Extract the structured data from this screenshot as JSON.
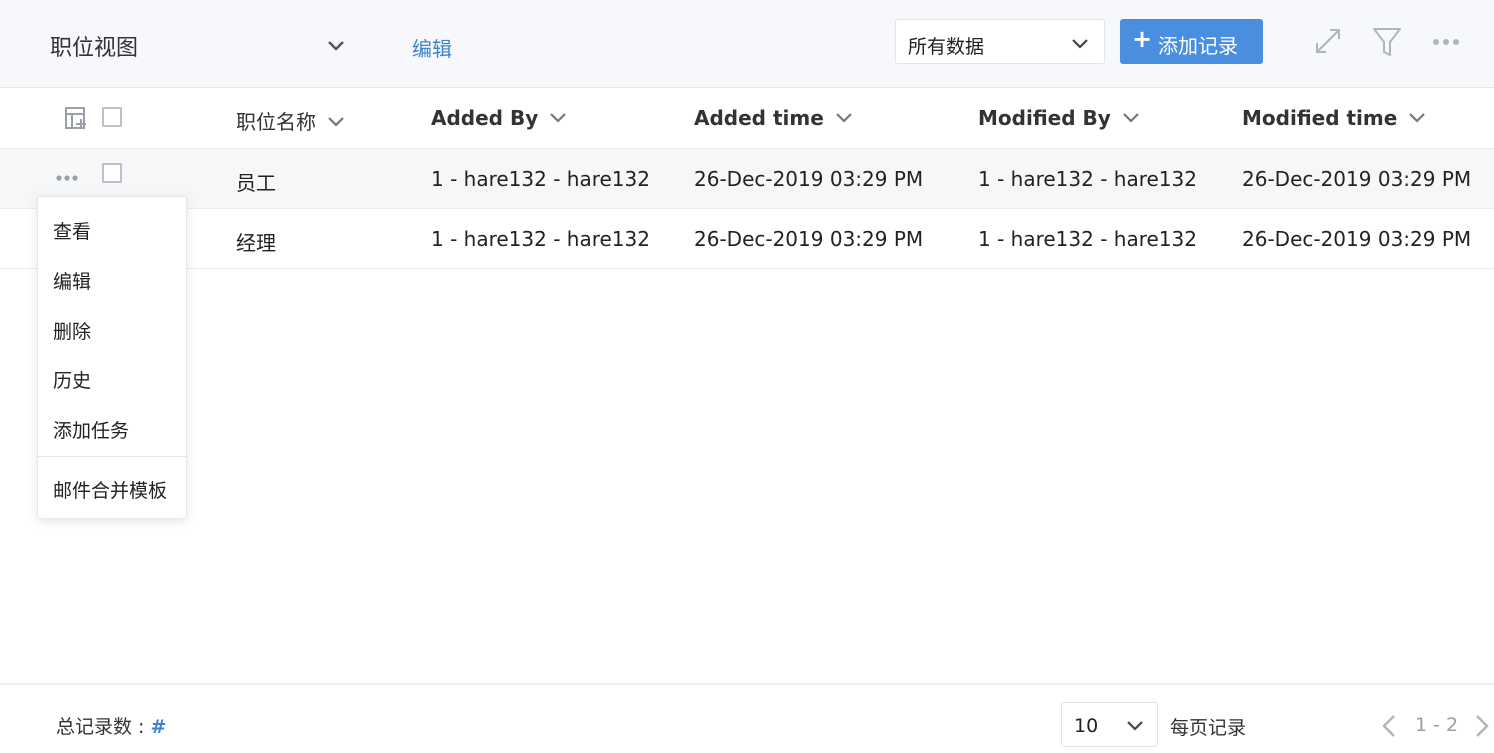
{
  "header": {
    "view_title": "职位视图",
    "edit_label": "编辑",
    "data_filter": "所有数据",
    "add_button": {
      "icon": "+",
      "label": "添加记录"
    },
    "icons": [
      "expand-icon",
      "filter-icon",
      "more-icon"
    ]
  },
  "table": {
    "columns": [
      "职位名称",
      "Added By",
      "Added time",
      "Modified By",
      "Modified time"
    ],
    "rows": [
      {
        "name": "员工",
        "added_by": "1 - hare132 - hare132",
        "added_time": "26-Dec-2019 03:29 PM",
        "modified_by": "1 - hare132 - hare132",
        "modified_time": "26-Dec-2019 03:29 PM"
      },
      {
        "name": "经理",
        "added_by": "1 - hare132 - hare132",
        "added_time": "26-Dec-2019 03:29 PM",
        "modified_by": "1 - hare132 - hare132",
        "modified_time": "26-Dec-2019 03:29 PM"
      }
    ]
  },
  "context_menu": {
    "items": [
      "查看",
      "编辑",
      "删除",
      "历史",
      "添加任务"
    ],
    "extra_item": "邮件合并模板"
  },
  "footer": {
    "total_label": "总记录数 : ",
    "total_value": "#",
    "per_page_value": "10",
    "per_page_label": "每页记录",
    "page_range": "1 - 2"
  },
  "colors": {
    "accent": "#4a8ee0",
    "link": "#3f83cc",
    "header_bg": "#f6f8fb",
    "icon_gray": "#b0b5bc"
  }
}
